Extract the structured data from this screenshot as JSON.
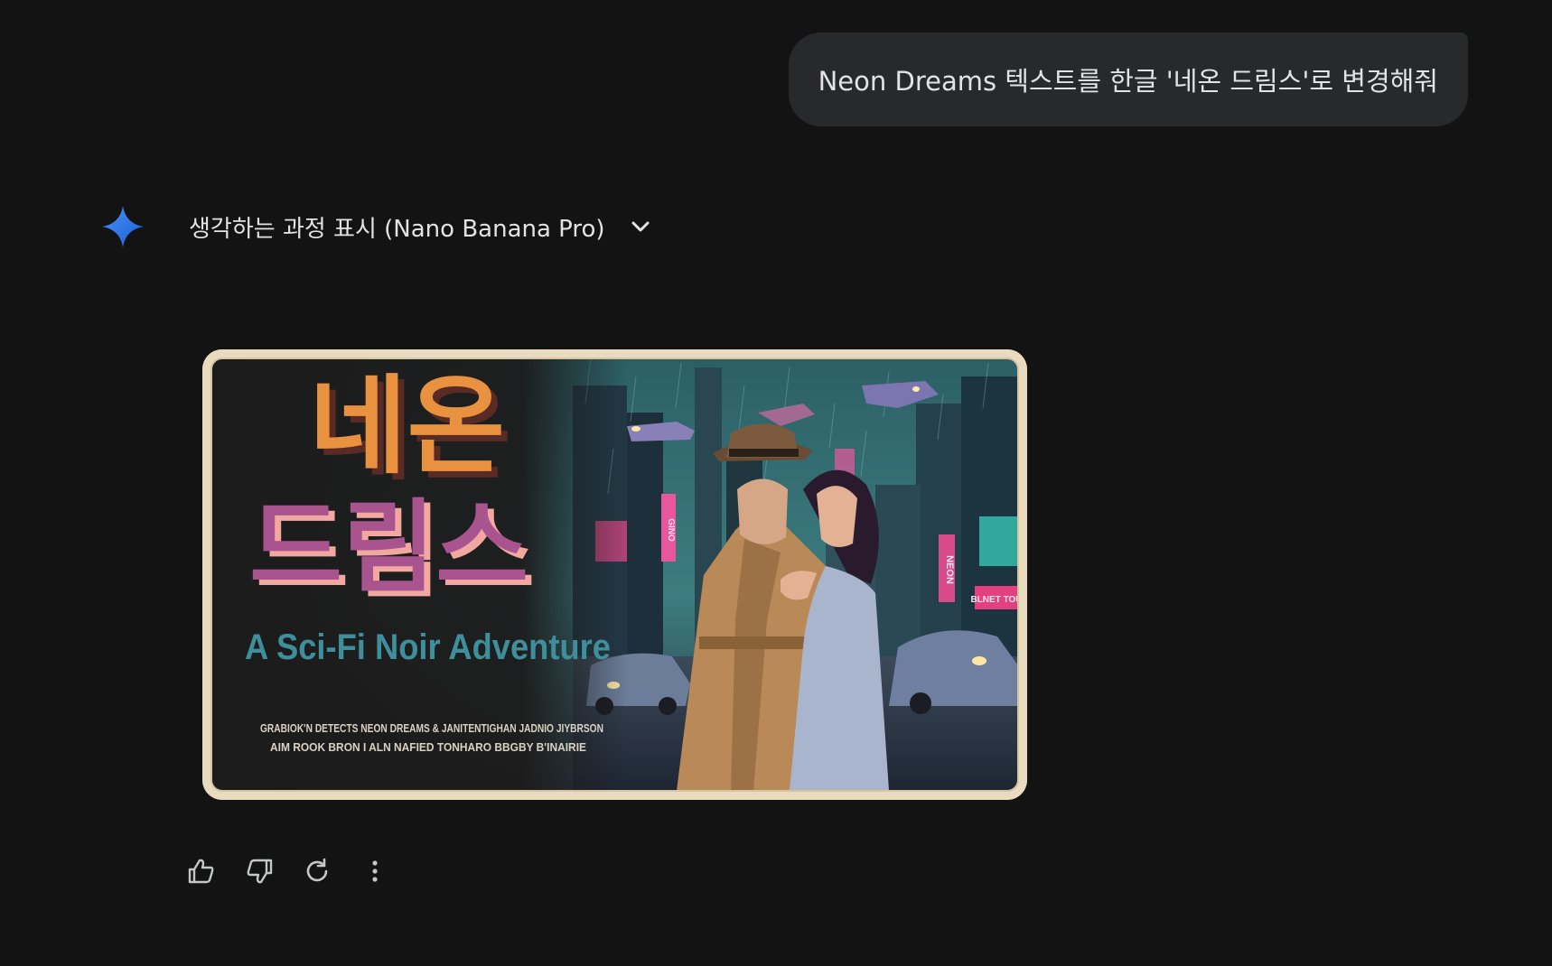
{
  "user_message": {
    "text": "Neon Dreams 텍스트를 한글 '네온 드림스'로 변경해줘"
  },
  "assistant": {
    "icon": "gemini-spark-icon",
    "thinking_toggle_label": "생각하는 과정 표시 (Nano Banana Pro)",
    "image": {
      "title_line_1": "네온",
      "title_line_2": "드림스",
      "subtitle": "A Sci-Fi Noir Adventure",
      "credit_line_1": "GRABIOK'N DETECTS  NEON DREAMS & JANITENTIGHAN  JADNIO JIYBRSON",
      "credit_line_2": "AIM ROOK  BRON I ALN  NAFIED TONHARO  BBGBY B'INAIRIE",
      "sign_1": "NEON",
      "sign_2": "GINO",
      "sign_3": "BLNET TOU"
    },
    "actions": [
      {
        "name": "thumbs-up-icon"
      },
      {
        "name": "thumbs-down-icon"
      },
      {
        "name": "regenerate-icon"
      },
      {
        "name": "more-vert-icon"
      }
    ]
  },
  "colors": {
    "background": "#131314",
    "bubble": "#28292b",
    "text": "#e3e3e3",
    "title_orange": "#e8913f",
    "title_purple": "#a9548f",
    "subtitle_teal": "#3f8e9b"
  }
}
